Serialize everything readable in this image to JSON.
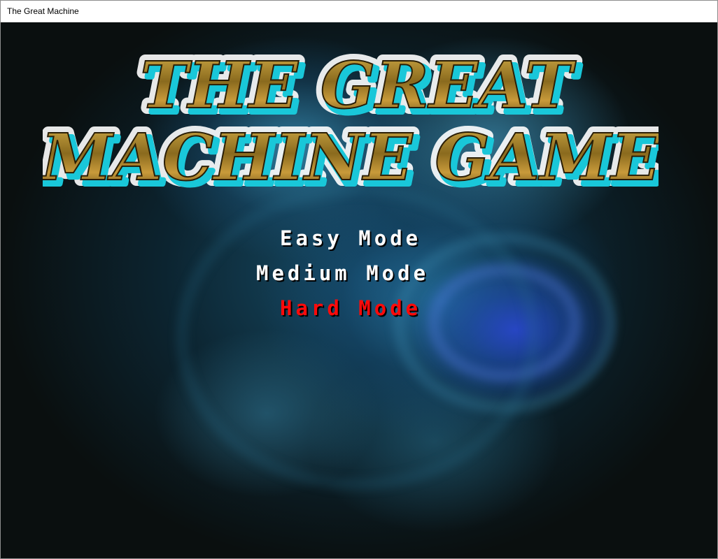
{
  "window": {
    "title": "The Great Machine"
  },
  "logo": {
    "line1": "THE GREAT",
    "line2": "MACHINE GAME"
  },
  "menu": {
    "items": [
      {
        "label": "Easy Mode",
        "color": "#ffffff",
        "selected": false
      },
      {
        "label": "Medium Mode",
        "color": "#ffffff",
        "selected": false
      },
      {
        "label": "Hard Mode",
        "color": "#ff0a0a",
        "selected": true
      }
    ]
  }
}
